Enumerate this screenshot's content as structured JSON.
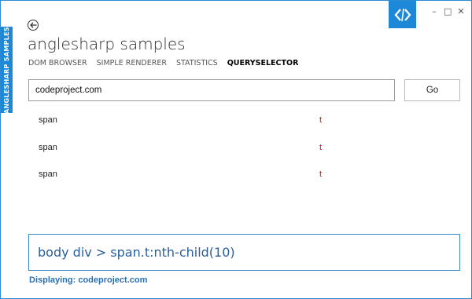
{
  "app": {
    "side_tab_label": "ANGLESHARP SAMPLES",
    "title": "anglesharp samples",
    "accent_color": "#1e88d8"
  },
  "window_controls": {
    "minimize": "–",
    "maximize": "□",
    "close": "✕"
  },
  "nav": {
    "items": [
      {
        "label": "DOM BROWSER",
        "active": false
      },
      {
        "label": "SIMPLE RENDERER",
        "active": false
      },
      {
        "label": "STATISTICS",
        "active": false
      },
      {
        "label": "QUERYSELECTOR",
        "active": true
      }
    ]
  },
  "url_bar": {
    "value": "codeproject.com",
    "go_label": "Go"
  },
  "results": [
    {
      "tag": "span",
      "text": "t"
    },
    {
      "tag": "span",
      "text": "t"
    },
    {
      "tag": "span",
      "text": "t"
    }
  ],
  "query": {
    "value": "body div > span.t:nth-child(10)"
  },
  "status": {
    "text": "Displaying: codeproject.com"
  },
  "icons": {
    "back": "arrow-left-icon",
    "logo": "code-chevrons-icon"
  }
}
